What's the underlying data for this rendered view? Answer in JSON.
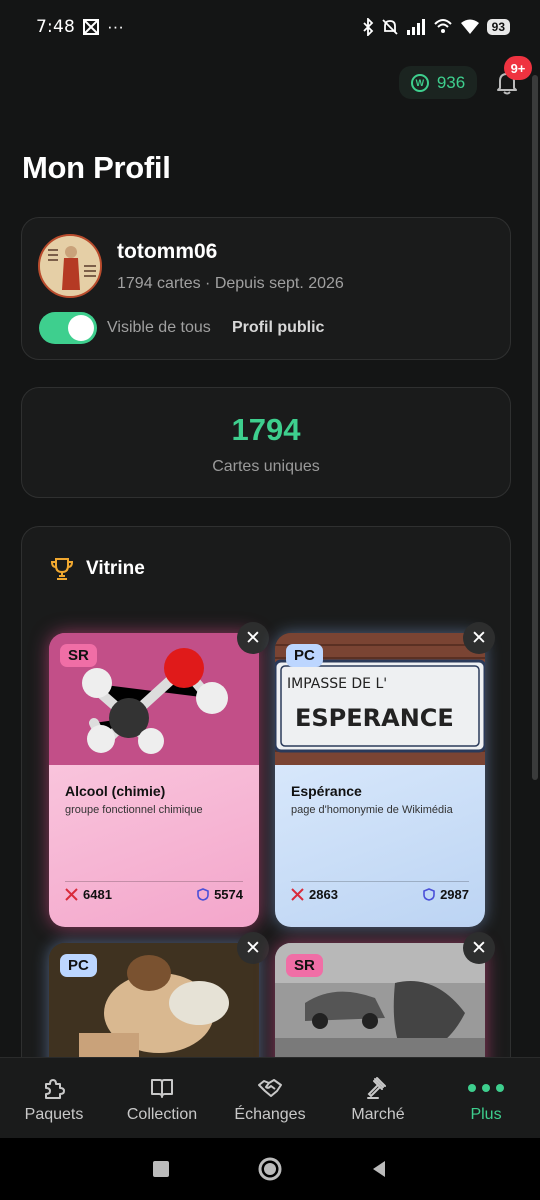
{
  "status_bar": {
    "time": "7:48",
    "dots": "···",
    "battery": "93"
  },
  "header": {
    "coins": "936",
    "coin_symbol": "W",
    "notifications_badge": "9+"
  },
  "page": {
    "title": "Mon Profil"
  },
  "profile": {
    "username": "totomm06",
    "meta": "1794 cartes · Depuis sept. 2026",
    "visibility_label": "Visible de tous",
    "visibility_on": true,
    "public_label": "Profil public"
  },
  "stats": {
    "value": "1794",
    "label": "Cartes uniques"
  },
  "showcase": {
    "title": "Vitrine",
    "cards": [
      {
        "rarity": "SR",
        "title": "Alcool (chimie)",
        "subtitle": "groupe fonctionnel chimique",
        "attack": "6481",
        "defense": "5574",
        "color": "#f7b3d4"
      },
      {
        "rarity": "PC",
        "title": "Espérance",
        "subtitle": "page d'homonymie de Wikimédia",
        "attack": "2863",
        "defense": "2987",
        "color": "#c9def8",
        "sign_line1": "IMPASSE DE L'",
        "sign_line2": "ESPERANCE"
      },
      {
        "rarity": "PC"
      },
      {
        "rarity": "SR"
      }
    ]
  },
  "bottom_nav": {
    "items": [
      {
        "label": "Paquets",
        "icon": "puzzle-icon"
      },
      {
        "label": "Collection",
        "icon": "book-icon"
      },
      {
        "label": "Échanges",
        "icon": "handshake-icon"
      },
      {
        "label": "Marché",
        "icon": "gavel-icon"
      },
      {
        "label": "Plus",
        "icon": "more-dots-icon",
        "active": true
      }
    ]
  },
  "colors": {
    "accent": "#3ecf8e",
    "background": "#141515",
    "badge": "#ef3340",
    "rarity_sr": "#f06ea6",
    "rarity_pc": "#bcd6ff"
  }
}
